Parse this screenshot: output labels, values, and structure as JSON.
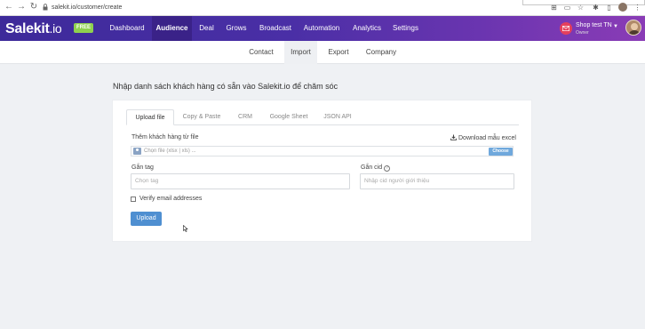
{
  "browser": {
    "url": "salekit.io/customer/create"
  },
  "app": {
    "logo_main": "Salekit",
    "logo_suffix": ".io",
    "plan_badge": "FREE",
    "menu": [
      {
        "label": "Dashboard"
      },
      {
        "label": "Audience"
      },
      {
        "label": "Deal"
      },
      {
        "label": "Grows"
      },
      {
        "label": "Broadcast"
      },
      {
        "label": "Automation"
      },
      {
        "label": "Analytics"
      },
      {
        "label": "Settings"
      }
    ],
    "active_menu": "Audience",
    "shop_name": "Shop test TN",
    "shop_role": "Owner"
  },
  "subnav": {
    "tabs": [
      {
        "label": "Contact"
      },
      {
        "label": "Import"
      },
      {
        "label": "Export"
      },
      {
        "label": "Company"
      }
    ],
    "active": "Import"
  },
  "page": {
    "heading": "Nhập danh sách khách hàng có sẵn vào Salekit.io để chăm sóc"
  },
  "import_card": {
    "tabs": [
      {
        "label": "Upload file"
      },
      {
        "label": "Copy & Paste"
      },
      {
        "label": "CRM"
      },
      {
        "label": "Google Sheet"
      },
      {
        "label": "JSON API"
      }
    ],
    "active_tab": "Upload file",
    "file_label": "Thêm khách hàng từ file",
    "download_label": "Download mẫu excel",
    "file_placeholder": "Chọn file (xlsx | xls) ...",
    "choose_label": "Choose",
    "tag_label": "Gắn tag",
    "tag_placeholder": "Chọn tag",
    "cid_label": "Gắn cid",
    "cid_placeholder": "Nhập cid người giới thiệu",
    "verify_label": "Verify email addresses",
    "verify_checked": false,
    "upload_label": "Upload"
  },
  "colors": {
    "appbar_start": "#3d2a9a",
    "appbar_end": "#8a3cb6",
    "free_badge": "#8fd14f",
    "primary_button": "#4f8fd1",
    "choose_button": "#6fa8dc",
    "mail_icon": "#e53f5c"
  }
}
